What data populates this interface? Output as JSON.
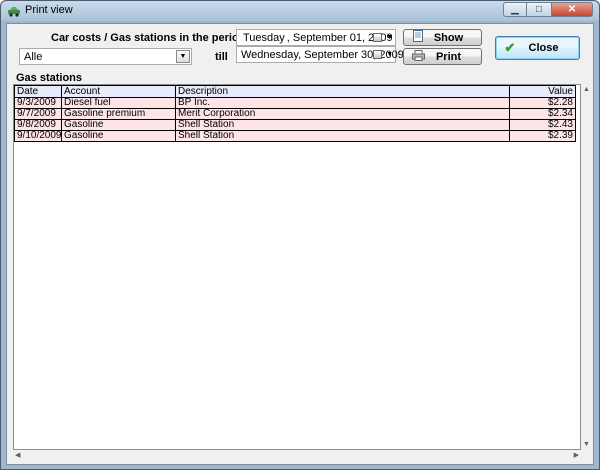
{
  "window": {
    "title": "Print view"
  },
  "header": {
    "period_label": "Car costs / Gas stations in the period of",
    "till_label": "till",
    "filter_value": "Alle",
    "date_from": {
      "weekday": "Tuesday",
      "date": ", September 01, 2009"
    },
    "date_to": "Wednesday, September 30, 2009"
  },
  "buttons": {
    "show": "Show",
    "print": "Print",
    "close": "Close"
  },
  "section": {
    "title": "Gas stations"
  },
  "table": {
    "columns": [
      "Date",
      "Account",
      "Description",
      "Value"
    ],
    "rows": [
      [
        "9/3/2009",
        "Diesel fuel",
        "BP Inc.",
        "$2.28"
      ],
      [
        "9/7/2009",
        "Gasoline premium",
        "Merit Corporation",
        "$2.34"
      ],
      [
        "9/8/2009",
        "Gasoline",
        "Shell Station",
        "$2.43"
      ],
      [
        "9/10/2009",
        "Gasoline",
        "Shell Station",
        "$2.39"
      ]
    ]
  },
  "icons": {
    "app": "car-icon",
    "show": "document-preview-icon",
    "print": "printer-icon",
    "close": "checkmark-icon"
  },
  "colors": {
    "header_row": "#e8ebfb",
    "data_row": "#fde4e6",
    "close_accent": "#3c7fb1",
    "check": "#2e9e2e"
  }
}
